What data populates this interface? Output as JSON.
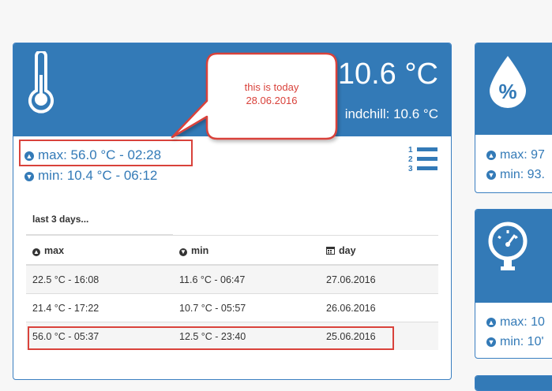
{
  "main": {
    "current_temp": "10.6 °C",
    "windchill": "indchill: 10.6 °C",
    "max_line": "max: 56.0 °C - 02:28",
    "min_line": "min: 10.4 °C - 06:12",
    "callout_line1": "this is today",
    "callout_line2": "28.06.2016",
    "table_title": "last 3 days...",
    "headers": {
      "max": "max",
      "min": "min",
      "day": "day"
    },
    "rows": [
      {
        "max": "22.5 °C - 16:08",
        "min": "11.6 °C - 06:47",
        "day": "27.06.2016"
      },
      {
        "max": "21.4 °C - 17:22",
        "min": "10.7 °C - 05:57",
        "day": "26.06.2016"
      },
      {
        "max": "56.0 °C - 05:37",
        "min": "12.5 °C - 23:40",
        "day": "25.06.2016"
      }
    ]
  },
  "side1": {
    "max_line": "max: 97",
    "min_line": "min: 93."
  },
  "side2": {
    "max_line": "max: 10",
    "min_line": "min: 10'"
  },
  "colors": {
    "primary": "#337ab7",
    "highlight": "#d9423b",
    "background": "#f7f7f7"
  },
  "icons": [
    "thermometer-icon",
    "humidity-icon",
    "pressure-gauge-icon",
    "numbered-list-icon",
    "arrow-up-circle-icon",
    "arrow-down-circle-icon",
    "calendar-icon"
  ]
}
